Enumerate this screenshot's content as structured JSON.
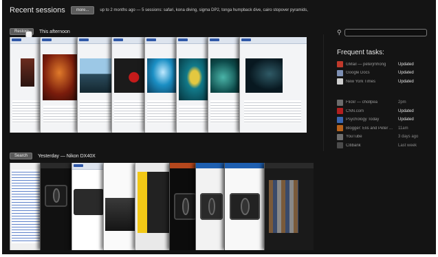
{
  "header": {
    "title": "Recent sessions",
    "more_label": "more...",
    "summary": "up to 2 months ago — 5 sessions: safari, kona diving, sigma DP2, tonga humpback dive, cairo stopover pyramids,"
  },
  "sessions": [
    {
      "button": "Restore",
      "when": "This afternoon"
    },
    {
      "button": "Search",
      "when": "Yesterday — Nikon DX40X"
    }
  ],
  "search": {
    "placeholder": ""
  },
  "frequent": {
    "title": "Frequent tasks:",
    "group1": [
      {
        "name": "GMail — peterjmhong",
        "status": "Updated",
        "icon_color": "#c0392b"
      },
      {
        "name": "Google Docs",
        "status": "Updated",
        "icon_color": "#7d8fb3"
      },
      {
        "name": "New York Times",
        "status": "Updated",
        "icon_color": "#cfcfcf"
      }
    ],
    "group2": [
      {
        "name": "Flickr — chollpea",
        "status": "2pm",
        "icon_color": "#6b6b6b"
      },
      {
        "name": "CNN.com",
        "status": "Updated",
        "icon_color": "#b21f1f"
      },
      {
        "name": "Psychology Today",
        "status": "Updated",
        "icon_color": "#3b66b0"
      },
      {
        "name": "Blogger: Elis and Peter ...",
        "status": "11am",
        "icon_color": "#b8621c"
      },
      {
        "name": "YouTube",
        "status": "3 days ago",
        "icon_color": "#6e6e6e"
      },
      {
        "name": "Citibank",
        "status": "Last week",
        "icon_color": "#4a4a4a"
      }
    ]
  },
  "colors": {
    "background": "#141414",
    "accent": "#5d5d5d"
  }
}
